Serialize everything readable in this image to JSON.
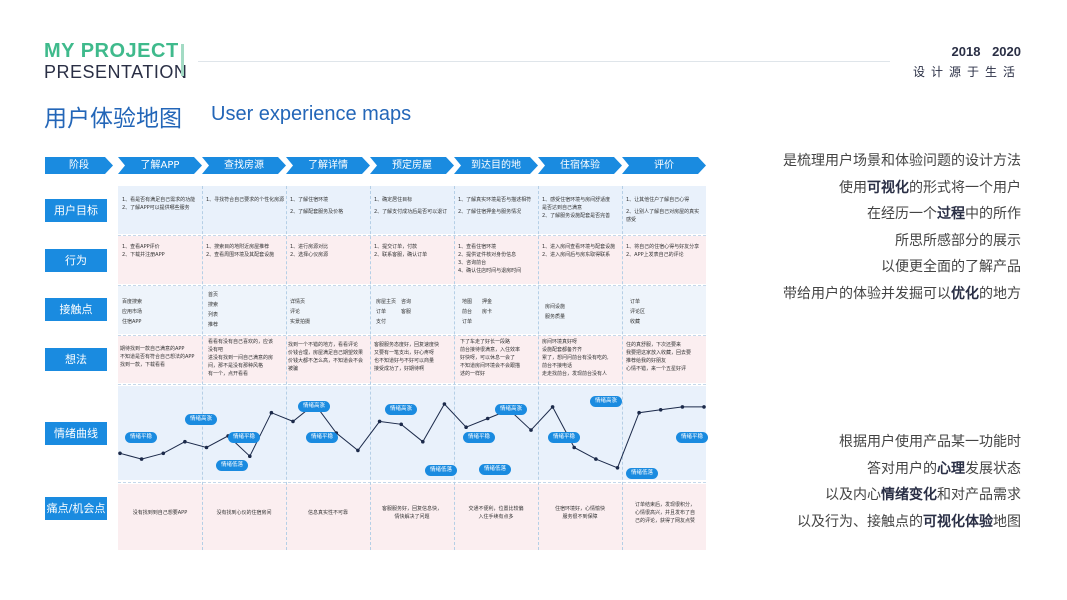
{
  "header": {
    "brand_line1": "MY PROJECT",
    "brand_line2": "PRESENTATION",
    "years": "2018 2020",
    "slogan": "设计源于生活"
  },
  "title": {
    "cn": "用户体验地图",
    "en": "User experience maps"
  },
  "colors": {
    "accent": "#1a8be0",
    "brand_green": "#3fba8c",
    "title_blue": "#2366b8"
  },
  "map": {
    "stage_label": "阶段",
    "stages": [
      "了解APP",
      "查找房源",
      "了解详情",
      "预定房屋",
      "到达目的地",
      "住宿体验",
      "评价"
    ],
    "row_labels": {
      "goals": "用户目标",
      "actions": "行为",
      "touch": "接触点",
      "thoughts": "想法",
      "emotion": "情绪曲线",
      "pain": "痛点/机会点"
    },
    "goals": [
      [
        "1、看是否有满足自己需求的功能",
        "2、了解APP可以提供哪些服务"
      ],
      [
        "1、寻找符合自己要求的个性化房源"
      ],
      [
        "1、了解住宿环境",
        "2、了解配套服务及价格"
      ],
      [
        "1、确定居住目标",
        "2、了解支付成功后是否可以退订"
      ],
      [
        "1、了解真实环境是否与描述相符",
        "2、了解住宿押金与服务情况"
      ],
      [
        "1、感受住宿环境与房间舒适度",
        "是否达到自己满意",
        "2、了解服务设施配套是否完善"
      ],
      [
        "1、让其他住户了解自己心得",
        "2、让别人了解自己对房屋的真实",
        "感受"
      ]
    ],
    "actions": [
      [
        "1、查看APP评价",
        "2、下载并注册APP"
      ],
      [
        "1、搜索目的地附近房屋推荐",
        "2、查看周围环境及其配套设施"
      ],
      [
        "1、进行房源对比",
        "2、选择心仪房源"
      ],
      [
        "1、提交订单，付款",
        "2、联系客服，确认订单"
      ],
      [
        "1、查看住宿环境",
        "2、提供证件核对身份信息",
        "3、咨询前台",
        "4、确认住店时间与退房时间"
      ],
      [
        "1、进入房间查看环境与配套设施",
        "2、进入房间后与房东取得联系"
      ],
      [
        "1、将自己的住宿心得与好友分享",
        "2、APP上发表自己的评论"
      ]
    ],
    "touch": [
      [
        "百度搜索",
        "应用市场",
        "住宿APP"
      ],
      [
        "首页",
        "搜索",
        "列表",
        "推荐"
      ],
      [
        "详情页",
        "评论",
        "实景拍摄"
      ],
      [
        "房屋主页　咨询",
        "订单　　　客服",
        "支付"
      ],
      [
        "地图　　押金",
        "前台　　房卡",
        "订单"
      ],
      [
        "房间设施",
        "服务质量"
      ],
      [
        "订单",
        "评论区",
        "收藏"
      ]
    ],
    "thoughts": [
      [
        "期待找到一款自己满意的APP",
        "不知道是否有符合自己想法的APP",
        "找到一款，下载看看"
      ],
      [
        "看看有没有自己喜欢的，应该",
        "没有吧",
        "进没有找到一间自己满意的房",
        "间，那不是没有那种风格",
        "有一个，点开看看"
      ],
      [
        "找到一个不错的地方，看看评论",
        "价钱合理，房屋满足自己期望效果",
        "价钱大都不怎么高，不知道会不会",
        "被骗"
      ],
      [
        "客服服务态度好，回复速度快",
        "又要有一笔支出，好心疼呀",
        "也不知道好与不好可以商量",
        "接受成功了，好期待啊"
      ],
      [
        "下了车走了好长一段路",
        "前台接待很满意，入住效率",
        "好快呀，可以休息一会了",
        "不知道房间环境会不会跟描",
        "述的一样好"
      ],
      [
        "房间环境真好呀",
        "设施配套都备齐齐",
        "累了，想问问前台有没有吃的,",
        "前台不接电话",
        "走走找前台，发现前台没有人"
      ],
      [
        "住的真舒服，下次还要来",
        "我要把这家放入收藏，回去要",
        "推荐给我的好朋友",
        "心情不错，来一个五星好评"
      ]
    ],
    "emotion_labels": [
      "情绪平稳",
      "情绪高涨",
      "情绪平稳",
      "情绪低落",
      "情绪高涨",
      "情绪平稳",
      "情绪高涨",
      "情绪低落",
      "情绪平稳",
      "情绪高涨",
      "情绪低落",
      "情绪平稳",
      "情绪高涨",
      "情绪低落",
      "情绪平稳"
    ],
    "emotion_levels": [
      0.15,
      0.05,
      0.15,
      0.35,
      0.25,
      0.45,
      0.1,
      0.85,
      0.7,
      1.0,
      0.5,
      0.2,
      0.7,
      0.65,
      0.35,
      1.0,
      0.6,
      0.75,
      0.9,
      0.55,
      0.95,
      0.25,
      0.05,
      -0.1,
      0.85,
      0.9,
      0.95,
      0.95
    ],
    "pain": [
      [
        "没有找到到自己想要APP"
      ],
      [
        "没有找到心仪的住宿房间"
      ],
      [
        "信息真实性不可靠"
      ],
      [
        "客服服务好，回复信息快，",
        "情快解决了问题"
      ],
      [
        "交通不便利，位置比较偏",
        "入住手续有点多"
      ],
      [
        "住宿环境好，心情愉快",
        "服务很不到保障"
      ],
      [
        "订单结束后，发现很积分，",
        "心情很高兴，并且发布了自",
        "己的评论，获得了网友点赞"
      ]
    ]
  },
  "right_text": {
    "p1": [
      [
        {
          "t": "是梳理用户场景和体验问题的设计方法",
          "b": false
        }
      ],
      [
        {
          "t": "使用",
          "b": false
        },
        {
          "t": "可视化",
          "b": true
        },
        {
          "t": "的形式将一个用户",
          "b": false
        }
      ],
      [
        {
          "t": "在经历一个",
          "b": false
        },
        {
          "t": "过程",
          "b": true
        },
        {
          "t": "中的所作",
          "b": false
        }
      ],
      [
        {
          "t": "所思所感部分的展示",
          "b": false
        }
      ],
      [
        {
          "t": "以便更全面的了解产品",
          "b": false
        }
      ],
      [
        {
          "t": "带给用户的体验并发掘可以",
          "b": false
        },
        {
          "t": "优化",
          "b": true
        },
        {
          "t": "的地方",
          "b": false
        }
      ]
    ],
    "p2": [
      [
        {
          "t": "根据用户使用产品某一功能时",
          "b": false
        }
      ],
      [
        {
          "t": "答对用户的",
          "b": false
        },
        {
          "t": "心理",
          "b": true
        },
        {
          "t": "发展状态",
          "b": false
        }
      ],
      [
        {
          "t": "以及内心",
          "b": false
        },
        {
          "t": "情绪变化",
          "b": true
        },
        {
          "t": "和对产品需求",
          "b": false
        }
      ],
      [
        {
          "t": "以及行为、接触点的",
          "b": false
        },
        {
          "t": "可视化体验",
          "b": true
        },
        {
          "t": "地图",
          "b": false
        }
      ]
    ]
  }
}
